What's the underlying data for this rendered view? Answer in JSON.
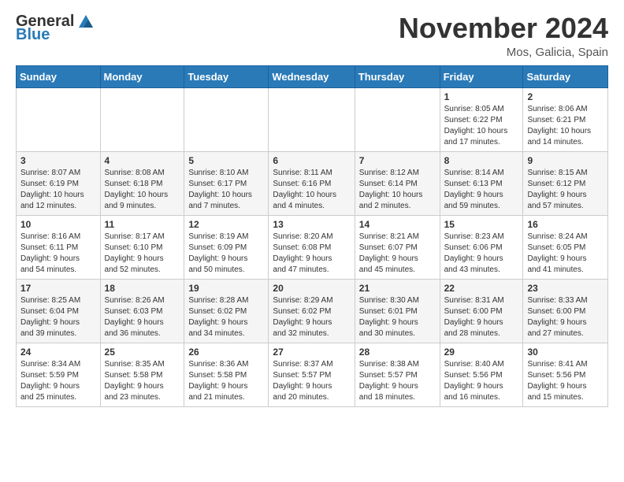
{
  "header": {
    "logo": {
      "general": "General",
      "blue": "Blue"
    },
    "title": "November 2024",
    "location": "Mos, Galicia, Spain"
  },
  "days_of_week": [
    "Sunday",
    "Monday",
    "Tuesday",
    "Wednesday",
    "Thursday",
    "Friday",
    "Saturday"
  ],
  "weeks": [
    {
      "days": [
        {
          "num": "",
          "info": ""
        },
        {
          "num": "",
          "info": ""
        },
        {
          "num": "",
          "info": ""
        },
        {
          "num": "",
          "info": ""
        },
        {
          "num": "",
          "info": ""
        },
        {
          "num": "1",
          "info": "Sunrise: 8:05 AM\nSunset: 6:22 PM\nDaylight: 10 hours\nand 17 minutes."
        },
        {
          "num": "2",
          "info": "Sunrise: 8:06 AM\nSunset: 6:21 PM\nDaylight: 10 hours\nand 14 minutes."
        }
      ]
    },
    {
      "days": [
        {
          "num": "3",
          "info": "Sunrise: 8:07 AM\nSunset: 6:19 PM\nDaylight: 10 hours\nand 12 minutes."
        },
        {
          "num": "4",
          "info": "Sunrise: 8:08 AM\nSunset: 6:18 PM\nDaylight: 10 hours\nand 9 minutes."
        },
        {
          "num": "5",
          "info": "Sunrise: 8:10 AM\nSunset: 6:17 PM\nDaylight: 10 hours\nand 7 minutes."
        },
        {
          "num": "6",
          "info": "Sunrise: 8:11 AM\nSunset: 6:16 PM\nDaylight: 10 hours\nand 4 minutes."
        },
        {
          "num": "7",
          "info": "Sunrise: 8:12 AM\nSunset: 6:14 PM\nDaylight: 10 hours\nand 2 minutes."
        },
        {
          "num": "8",
          "info": "Sunrise: 8:14 AM\nSunset: 6:13 PM\nDaylight: 9 hours\nand 59 minutes."
        },
        {
          "num": "9",
          "info": "Sunrise: 8:15 AM\nSunset: 6:12 PM\nDaylight: 9 hours\nand 57 minutes."
        }
      ]
    },
    {
      "days": [
        {
          "num": "10",
          "info": "Sunrise: 8:16 AM\nSunset: 6:11 PM\nDaylight: 9 hours\nand 54 minutes."
        },
        {
          "num": "11",
          "info": "Sunrise: 8:17 AM\nSunset: 6:10 PM\nDaylight: 9 hours\nand 52 minutes."
        },
        {
          "num": "12",
          "info": "Sunrise: 8:19 AM\nSunset: 6:09 PM\nDaylight: 9 hours\nand 50 minutes."
        },
        {
          "num": "13",
          "info": "Sunrise: 8:20 AM\nSunset: 6:08 PM\nDaylight: 9 hours\nand 47 minutes."
        },
        {
          "num": "14",
          "info": "Sunrise: 8:21 AM\nSunset: 6:07 PM\nDaylight: 9 hours\nand 45 minutes."
        },
        {
          "num": "15",
          "info": "Sunrise: 8:23 AM\nSunset: 6:06 PM\nDaylight: 9 hours\nand 43 minutes."
        },
        {
          "num": "16",
          "info": "Sunrise: 8:24 AM\nSunset: 6:05 PM\nDaylight: 9 hours\nand 41 minutes."
        }
      ]
    },
    {
      "days": [
        {
          "num": "17",
          "info": "Sunrise: 8:25 AM\nSunset: 6:04 PM\nDaylight: 9 hours\nand 39 minutes."
        },
        {
          "num": "18",
          "info": "Sunrise: 8:26 AM\nSunset: 6:03 PM\nDaylight: 9 hours\nand 36 minutes."
        },
        {
          "num": "19",
          "info": "Sunrise: 8:28 AM\nSunset: 6:02 PM\nDaylight: 9 hours\nand 34 minutes."
        },
        {
          "num": "20",
          "info": "Sunrise: 8:29 AM\nSunset: 6:02 PM\nDaylight: 9 hours\nand 32 minutes."
        },
        {
          "num": "21",
          "info": "Sunrise: 8:30 AM\nSunset: 6:01 PM\nDaylight: 9 hours\nand 30 minutes."
        },
        {
          "num": "22",
          "info": "Sunrise: 8:31 AM\nSunset: 6:00 PM\nDaylight: 9 hours\nand 28 minutes."
        },
        {
          "num": "23",
          "info": "Sunrise: 8:33 AM\nSunset: 6:00 PM\nDaylight: 9 hours\nand 27 minutes."
        }
      ]
    },
    {
      "days": [
        {
          "num": "24",
          "info": "Sunrise: 8:34 AM\nSunset: 5:59 PM\nDaylight: 9 hours\nand 25 minutes."
        },
        {
          "num": "25",
          "info": "Sunrise: 8:35 AM\nSunset: 5:58 PM\nDaylight: 9 hours\nand 23 minutes."
        },
        {
          "num": "26",
          "info": "Sunrise: 8:36 AM\nSunset: 5:58 PM\nDaylight: 9 hours\nand 21 minutes."
        },
        {
          "num": "27",
          "info": "Sunrise: 8:37 AM\nSunset: 5:57 PM\nDaylight: 9 hours\nand 20 minutes."
        },
        {
          "num": "28",
          "info": "Sunrise: 8:38 AM\nSunset: 5:57 PM\nDaylight: 9 hours\nand 18 minutes."
        },
        {
          "num": "29",
          "info": "Sunrise: 8:40 AM\nSunset: 5:56 PM\nDaylight: 9 hours\nand 16 minutes."
        },
        {
          "num": "30",
          "info": "Sunrise: 8:41 AM\nSunset: 5:56 PM\nDaylight: 9 hours\nand 15 minutes."
        }
      ]
    }
  ]
}
